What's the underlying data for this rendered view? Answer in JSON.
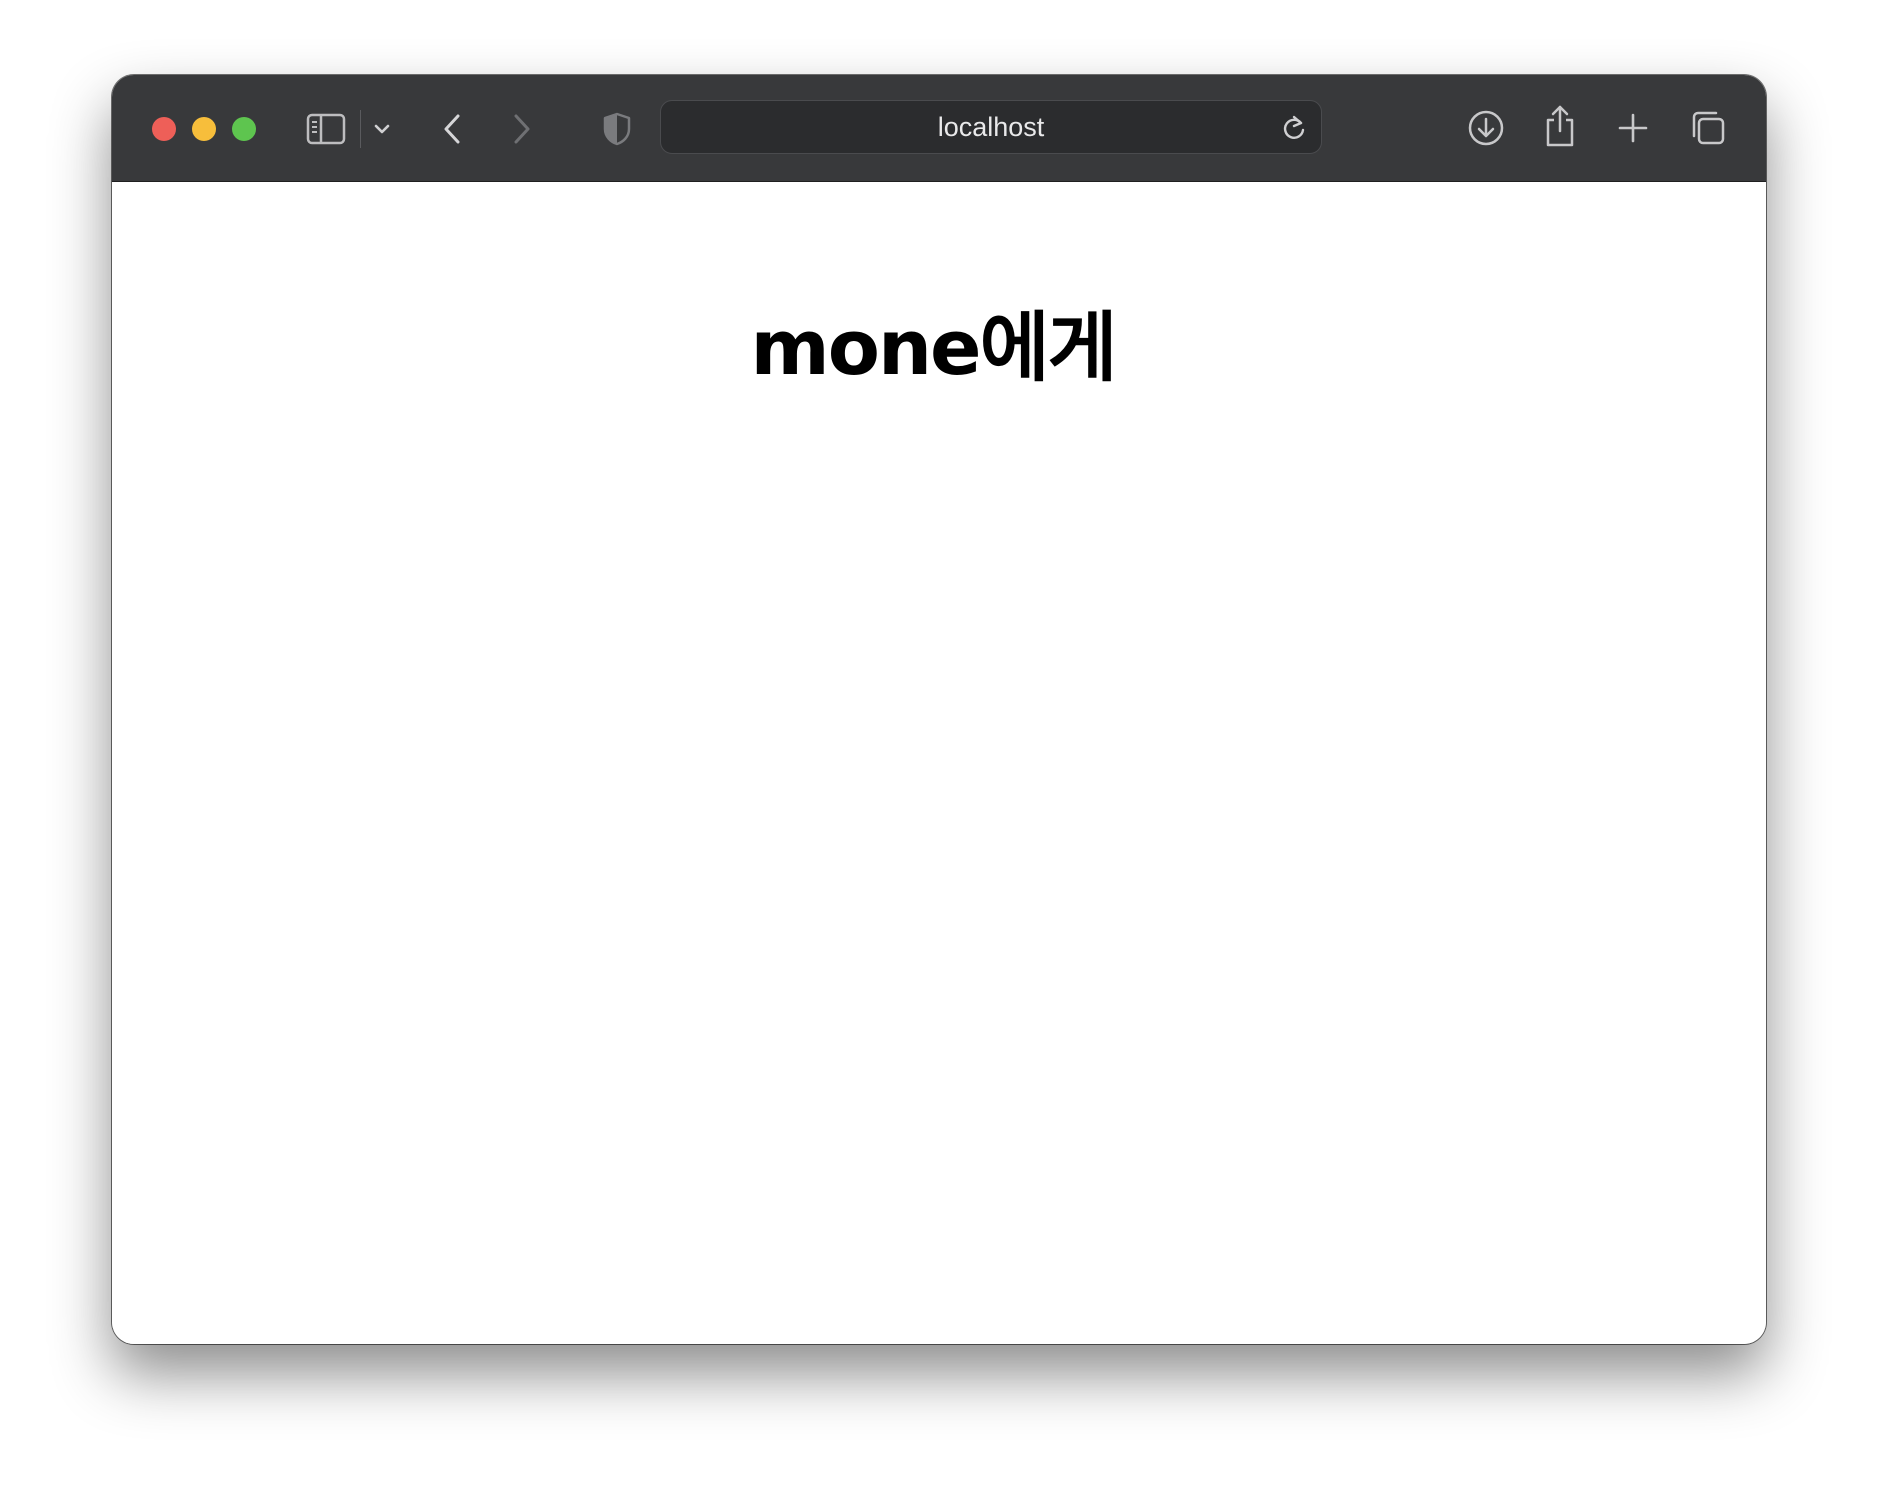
{
  "browser": {
    "url": "localhost",
    "traffic_lights": {
      "close_color": "#ee5f58",
      "minimize_color": "#f7be3b",
      "maximize_color": "#5ec54f"
    },
    "toolbar_icons": [
      "sidebar-icon",
      "chevron-down-icon",
      "back-icon",
      "forward-icon",
      "shield-icon",
      "reload-icon",
      "download-icon",
      "share-icon",
      "plus-icon",
      "tabs-icon"
    ]
  },
  "page": {
    "heading": "mone에게"
  }
}
